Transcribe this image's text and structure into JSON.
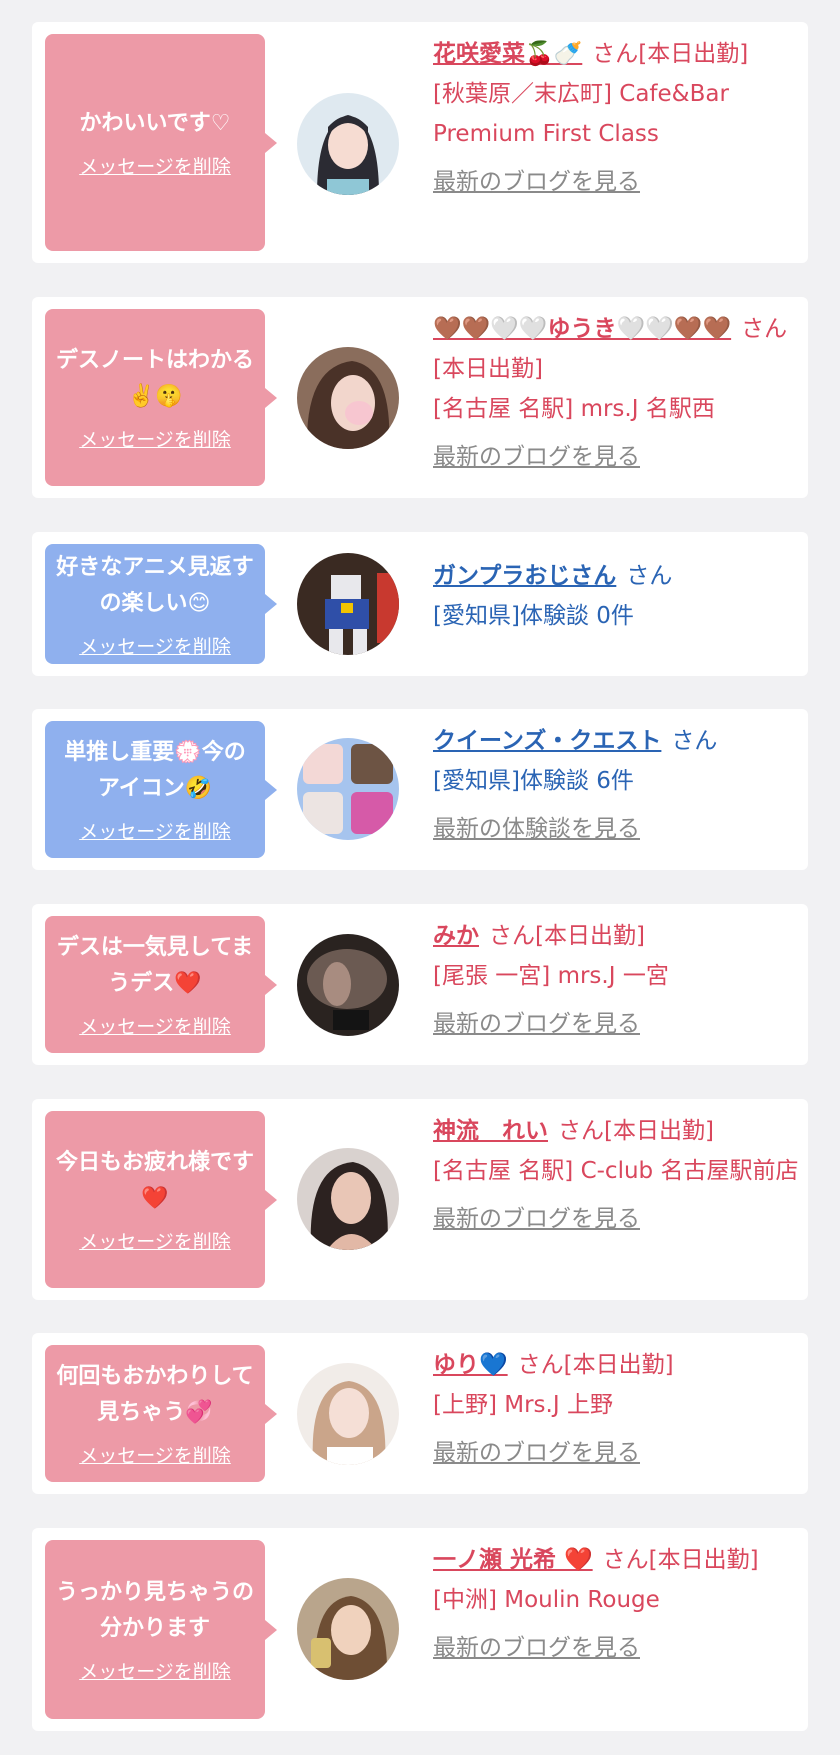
{
  "delete_label": "メッセージを削除",
  "cards": [
    {
      "message": "かわいいです♡",
      "name": "花咲愛菜🍒🍼",
      "suffix": "さん[本日出勤]",
      "detail": "[秋葉原／末広町] Cafe&Bar Premium First Class",
      "link": "最新のブログを見る"
    },
    {
      "message": "デスノートはわかる✌️🤫",
      "name": "🤎🤎🤍🤍ゆうき🤍🤍🤎🤎",
      "suffix": "さん[本日出勤]",
      "detail": "[名古屋 名駅] mrs.J 名駅西",
      "link": "最新のブログを見る"
    },
    {
      "message": "好きなアニメ見返すの楽しい😊",
      "name": "ガンプラおじさん",
      "suffix": "さん",
      "detail": "[愛知県]体験談 0件",
      "link": ""
    },
    {
      "message": "単推し重要💮今のアイコン🤣",
      "name": "クイーンズ・クエスト",
      "suffix": "さん",
      "detail": "[愛知県]体験談 6件",
      "link": "最新の体験談を見る"
    },
    {
      "message": "デスは一気見してまうデス❤️",
      "name": "みか",
      "suffix": "さん[本日出勤]",
      "detail": "[尾張 一宮] mrs.J 一宮",
      "link": "最新のブログを見る"
    },
    {
      "message": "今日もお疲れ様です❤️",
      "name": "神流　れい",
      "suffix": "さん[本日出勤]",
      "detail": "[名古屋 名駅] C-club 名古屋駅前店",
      "link": "最新のブログを見る"
    },
    {
      "message": "何回もおかわりして見ちゃう💞",
      "name": "ゆり💙",
      "suffix": "さん[本日出勤]",
      "detail": "[上野] Mrs.J 上野",
      "link": "最新のブログを見る"
    },
    {
      "message": "うっかり見ちゃうの分かります",
      "name": "一ノ瀬 光希 ❤️",
      "suffix": "さん[本日出勤]",
      "detail": "[中洲] Moulin Rouge",
      "link": "最新のブログを見る"
    }
  ]
}
